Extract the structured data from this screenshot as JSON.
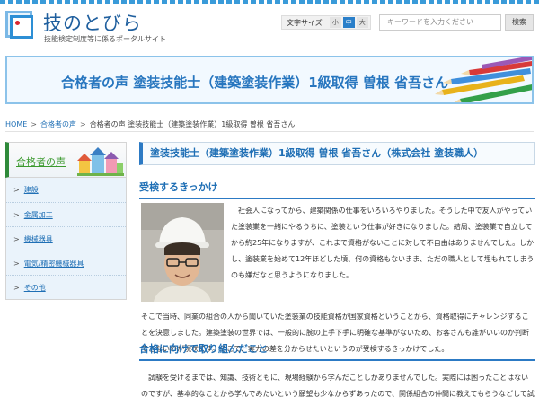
{
  "header": {
    "site_title": "技のとびら",
    "site_subtitle": "技能検定制度等に係るポータルサイト",
    "font_size_label": "文字サイズ",
    "font_sizes": [
      "小",
      "中",
      "大"
    ],
    "search_placeholder": "キーワードを入力ください",
    "search_button": "検索"
  },
  "banner": {
    "title": "合格者の声 塗装技能士（建築塗装作業）1級取得 曽根 省吾さん"
  },
  "breadcrumb": {
    "home": "HOME",
    "parent": "合格者の声",
    "current": "合格者の声 塗装技能士（建築塗装作業）1級取得 曽根 省吾さん"
  },
  "sidebar": {
    "title": "合格者の声",
    "items": [
      {
        "label": "建設"
      },
      {
        "label": "金属加工"
      },
      {
        "label": "機械器具"
      },
      {
        "label": "電気/精密機械器具"
      },
      {
        "label": "その他"
      }
    ]
  },
  "main": {
    "heading": "塗装技能士（建築塗装作業）1級取得 曽根 省吾さん（株式会社 塗装職人）",
    "section1": {
      "title": "受検するきっかけ",
      "text": "社会人になってから、建築関係の仕事をいろいろやりました。そうした中で友人がやっていた塗装業を一緒にやるうちに、塗装という仕事が好きになりました。結局、塗装業で自立してから約25年になりますが、これまで資格がないことに対して不自由はありませんでした。しかし、塗装業を始めて12年ほどした頃、何の資格もないまま、ただの職人として埋もれてしまうのも嫌だなと思うようになりました。",
      "text_cont": "そこで当時、同業の組合の人から聞いていた塗装業の技能資格が国家資格ということから、資格取得にチャレンジすることを決意しました。建築塗装の世界では、一般的に腕の上手下手に明確な基準がないため、お客さんも誰がいいのか判断できないのが現状です。そこで、実力の差を分からせたいというのが受検するきっかけでした。"
    },
    "section2": {
      "title": "合格に向けて取り組んだこと",
      "text": "試験を受けるまでは、知識、技術ともに、現場経験から学んだことしかありませんでした。実際には困ったことはないのですが、基本的なことから学んでみたいという願望も少なからずあったので、関係組合の仲間に教えてもらうなどして試験対策をしました。とくに、実技では、普段は外壁の塗装がおもな仕事なので、内装の"
    }
  },
  "colors": {
    "brand_blue": "#2776bf",
    "banner_border": "#8cc3ea",
    "sidebar_green": "#3c9a2e"
  }
}
